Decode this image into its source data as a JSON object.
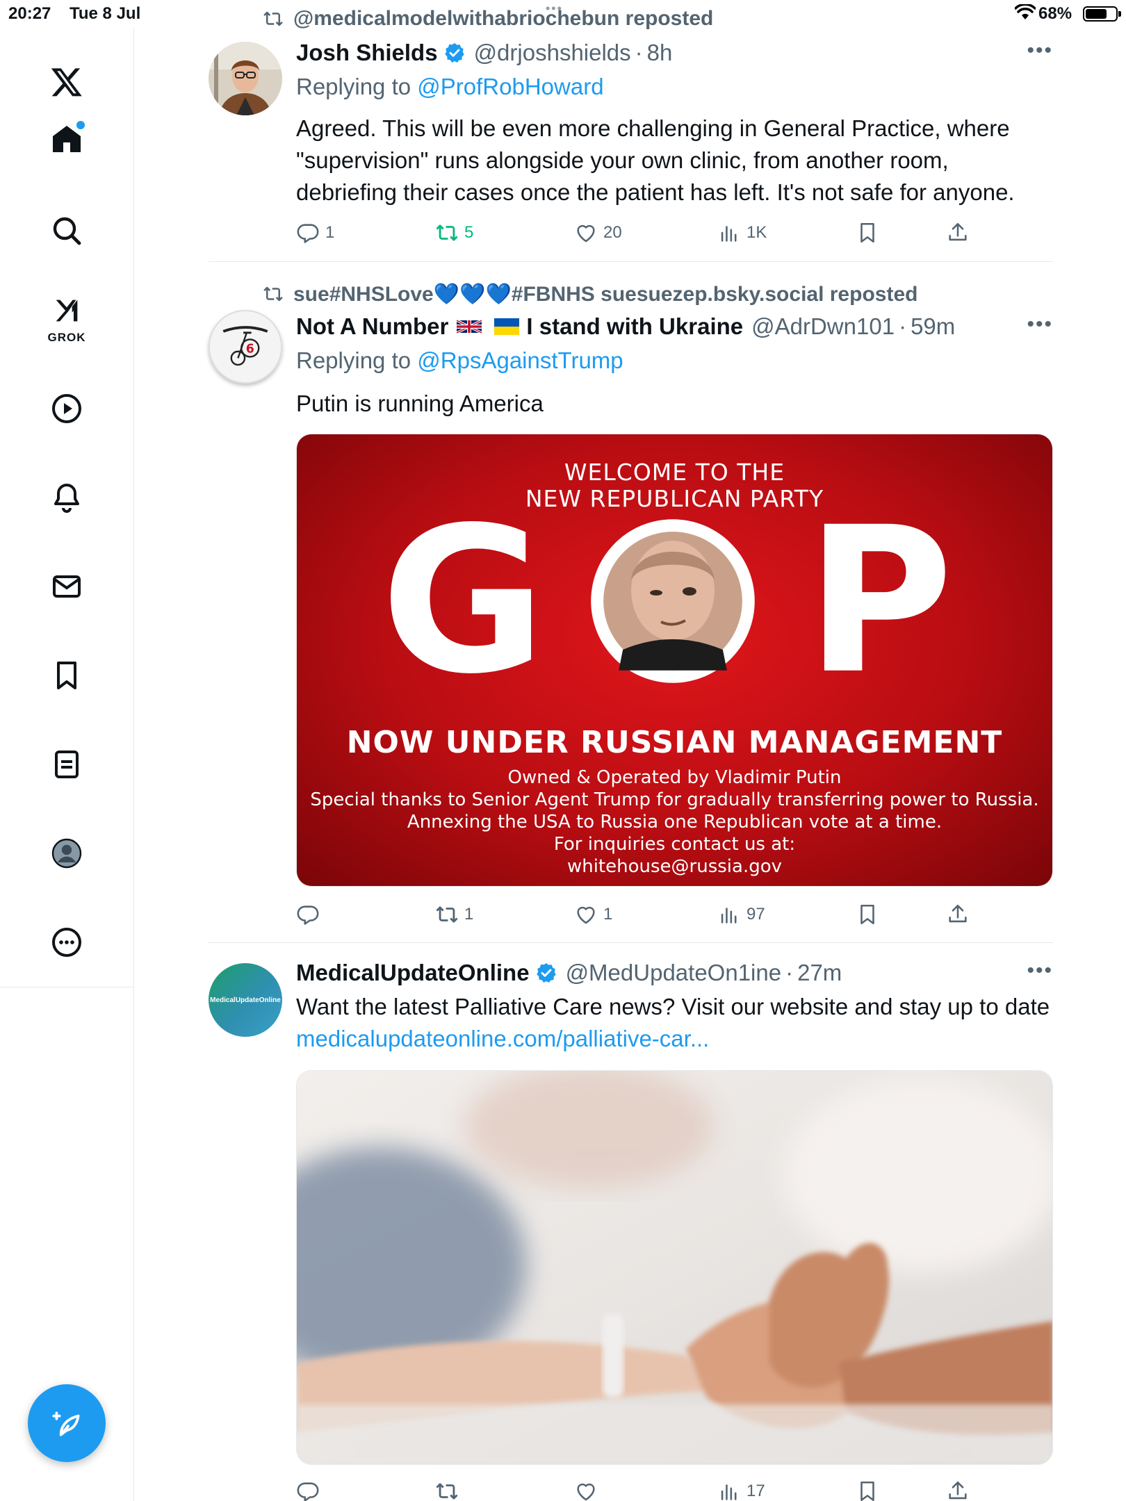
{
  "status_bar": {
    "time": "20:27",
    "date": "Tue 8 Jul",
    "battery": "68%"
  },
  "sidebar": {
    "items": [
      {
        "name": "x-logo",
        "icon": "x-logo-icon"
      },
      {
        "name": "home",
        "icon": "home-icon",
        "has_dot": true
      },
      {
        "name": "explore",
        "icon": "search-icon"
      },
      {
        "name": "grok",
        "icon": "grok-icon",
        "label": "GROK"
      },
      {
        "name": "videos",
        "icon": "play-icon"
      },
      {
        "name": "notifications",
        "icon": "bell-icon"
      },
      {
        "name": "messages",
        "icon": "mail-icon"
      },
      {
        "name": "bookmarks",
        "icon": "bookmark-icon"
      },
      {
        "name": "lists",
        "icon": "list-icon"
      },
      {
        "name": "profile",
        "icon": "avatar-icon"
      },
      {
        "name": "more",
        "icon": "more-icon"
      }
    ],
    "compose_icon": "compose-icon"
  },
  "posts": [
    {
      "repost_by": "@medicalmodelwithabriochebun reposted",
      "display_name": "Josh Shields",
      "verified": true,
      "handle": "@drjoshshields",
      "time": "8h",
      "replying_to_prefix": "Replying to",
      "replying_to": "@ProfRobHoward",
      "text_lines": [
        "Agreed. This will be even more challenging in General Practice, where",
        "\"supervision\" runs alongside your own clinic, from another room,",
        "debriefing their cases once the patient has left. It's not safe for anyone."
      ],
      "stats": {
        "replies": "1",
        "reposts": "5",
        "likes": "20",
        "views": "1K"
      }
    },
    {
      "repost_by": "sue#NHSLove💙💙💙#FBNHS suesuezep.bsky.social reposted",
      "display_name_parts": [
        "Not A Number",
        "I stand with Ukraine"
      ],
      "handle": "@AdrDwn101",
      "time": "59m",
      "replying_to_prefix": "Replying to",
      "replying_to": "@RpsAgainstTrump",
      "text": "Putin is running America",
      "image": {
        "welcome_line1": "WELCOME TO THE",
        "welcome_line2": "NEW REPUBLICAN PARTY",
        "big_text_g": "G",
        "big_text_p": "P",
        "headline": "NOW UNDER RUSSIAN MANAGEMENT",
        "lines": [
          "Owned & Operated by Vladimir Putin",
          "Special thanks to Senior Agent Trump for gradually transferring power to Russia.",
          "Annexing the USA to Russia one Republican vote at a time.",
          "For inquiries contact us at:",
          "whitehouse@russia.gov"
        ]
      },
      "stats": {
        "replies": "",
        "reposts": "1",
        "likes": "1",
        "views": "97"
      }
    },
    {
      "display_name": "MedicalUpdateOnline",
      "verified": true,
      "handle": "@MedUpdateOn1ine",
      "time": "27m",
      "avatar_text": "MedicalUpdateOnline",
      "text": "Want the latest Palliative Care news? Visit our website and stay up to date",
      "link": "medicalupdateonline.com/palliative-car...",
      "stats": {
        "replies": "",
        "reposts": "",
        "likes": "",
        "views": "17"
      }
    }
  ],
  "colors": {
    "accent": "#1d9bf0",
    "repost_green": "#00ba7c",
    "secondary_text": "#536471",
    "divider": "#e6e9ec"
  }
}
